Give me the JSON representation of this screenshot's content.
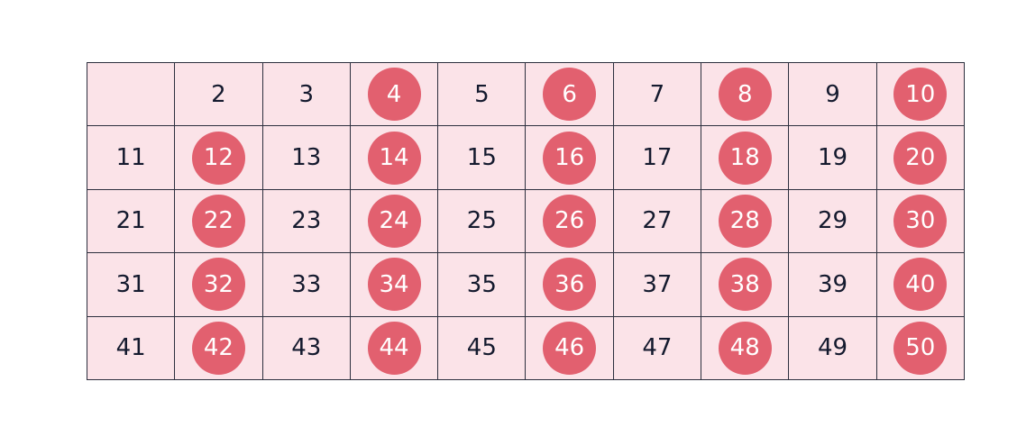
{
  "grid": {
    "rows": [
      [
        {
          "label": "",
          "circled": false
        },
        {
          "label": "2",
          "circled": false
        },
        {
          "label": "3",
          "circled": false
        },
        {
          "label": "4",
          "circled": true
        },
        {
          "label": "5",
          "circled": false
        },
        {
          "label": "6",
          "circled": true
        },
        {
          "label": "7",
          "circled": false
        },
        {
          "label": "8",
          "circled": true
        },
        {
          "label": "9",
          "circled": false
        },
        {
          "label": "10",
          "circled": true
        }
      ],
      [
        {
          "label": "11",
          "circled": false
        },
        {
          "label": "12",
          "circled": true
        },
        {
          "label": "13",
          "circled": false
        },
        {
          "label": "14",
          "circled": true
        },
        {
          "label": "15",
          "circled": false
        },
        {
          "label": "16",
          "circled": true
        },
        {
          "label": "17",
          "circled": false
        },
        {
          "label": "18",
          "circled": true
        },
        {
          "label": "19",
          "circled": false
        },
        {
          "label": "20",
          "circled": true
        }
      ],
      [
        {
          "label": "21",
          "circled": false
        },
        {
          "label": "22",
          "circled": true
        },
        {
          "label": "23",
          "circled": false
        },
        {
          "label": "24",
          "circled": true
        },
        {
          "label": "25",
          "circled": false
        },
        {
          "label": "26",
          "circled": true
        },
        {
          "label": "27",
          "circled": false
        },
        {
          "label": "28",
          "circled": true
        },
        {
          "label": "29",
          "circled": false
        },
        {
          "label": "30",
          "circled": true
        }
      ],
      [
        {
          "label": "31",
          "circled": false
        },
        {
          "label": "32",
          "circled": true
        },
        {
          "label": "33",
          "circled": false
        },
        {
          "label": "34",
          "circled": true
        },
        {
          "label": "35",
          "circled": false
        },
        {
          "label": "36",
          "circled": true
        },
        {
          "label": "37",
          "circled": false
        },
        {
          "label": "38",
          "circled": true
        },
        {
          "label": "39",
          "circled": false
        },
        {
          "label": "40",
          "circled": true
        }
      ],
      [
        {
          "label": "41",
          "circled": false
        },
        {
          "label": "42",
          "circled": true
        },
        {
          "label": "43",
          "circled": false
        },
        {
          "label": "44",
          "circled": true
        },
        {
          "label": "45",
          "circled": false
        },
        {
          "label": "46",
          "circled": true
        },
        {
          "label": "47",
          "circled": false
        },
        {
          "label": "48",
          "circled": true
        },
        {
          "label": "49",
          "circled": false
        },
        {
          "label": "50",
          "circled": true
        }
      ]
    ]
  },
  "colors": {
    "cell_background": "#fbe3e8",
    "circle_fill": "#e2606f",
    "grid_line": "#2c2f3e",
    "number_text": "#141a2e",
    "circled_number_text": "#ffffff"
  }
}
